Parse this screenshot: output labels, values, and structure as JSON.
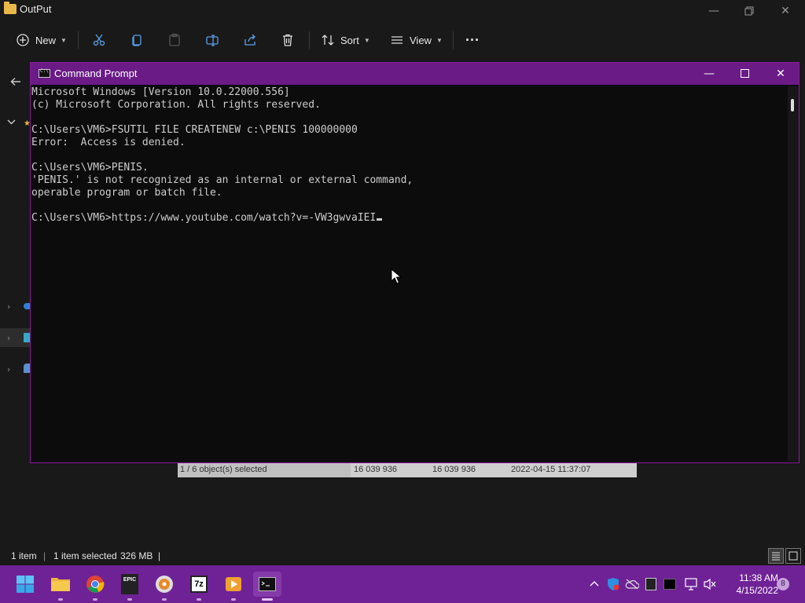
{
  "explorer": {
    "title": "OutPut",
    "toolbar": {
      "new_label": "New",
      "sort_label": "Sort",
      "view_label": "View",
      "more_label": "···"
    },
    "status": {
      "count": "1 item",
      "selected": "1 item selected",
      "size": "326 MB",
      "separator": "|"
    }
  },
  "details_row": {
    "selection": "1 / 6 object(s) selected",
    "size1": "16 039 936",
    "size2": "16 039 936",
    "modified": "2022-04-15 11:37:07"
  },
  "cmd": {
    "title": "Command Prompt",
    "lines": [
      "Microsoft Windows [Version 10.0.22000.556]",
      "(c) Microsoft Corporation. All rights reserved.",
      "",
      "C:\\Users\\VM6>FSUTIL FILE CREATENEW c:\\PENIS 100000000",
      "Error:  Access is denied.",
      "",
      "C:\\Users\\VM6>PENIS.",
      "'PENIS.' is not recognized as an internal or external command,",
      "operable program or batch file.",
      "",
      "C:\\Users\\VM6>https://www.youtube.com/watch?v=-VW3gwvaIEI"
    ]
  },
  "taskbar": {
    "time": "11:38 AM",
    "date": "4/15/2022",
    "notifications": "8",
    "epic_label": "EPIC",
    "zip_label": "7z"
  },
  "colors": {
    "taskbar": "#6f2296",
    "cmd_titlebar": "#6a1b86",
    "console_bg": "#0c0c0c",
    "console_text": "#cccccc"
  }
}
